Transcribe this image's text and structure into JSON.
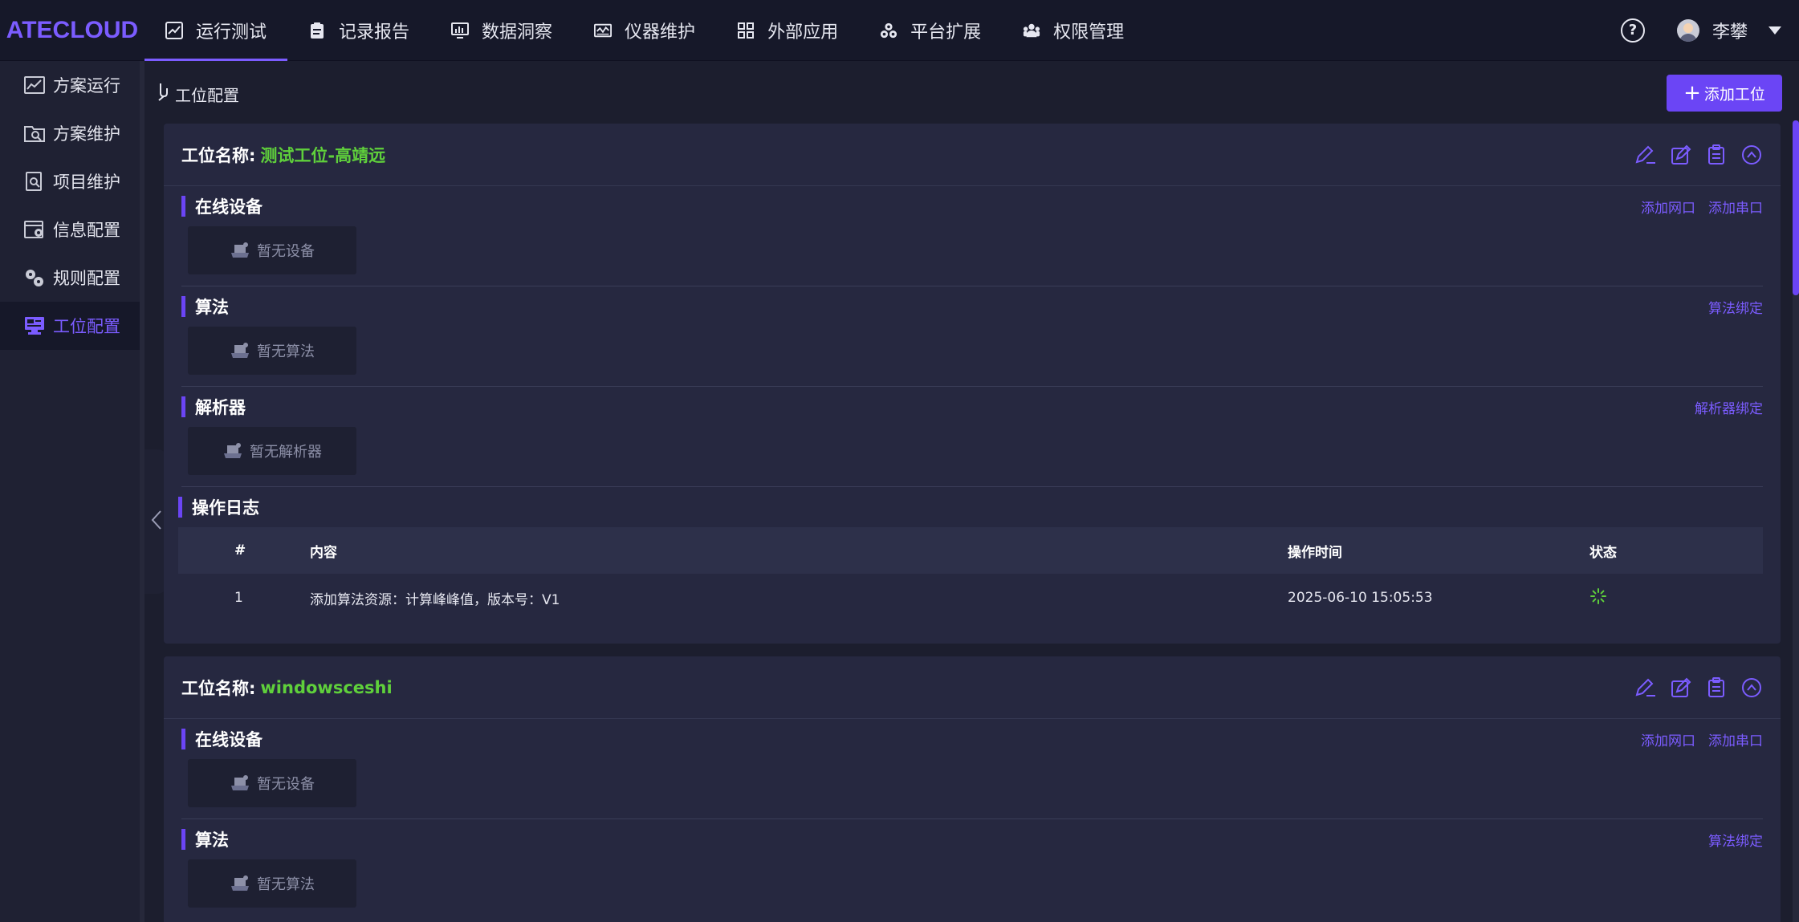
{
  "app": {
    "logo": "ATECLOUD"
  },
  "topnav": {
    "items": [
      {
        "label": "运行测试",
        "icon": "line-chart-icon",
        "active": true
      },
      {
        "label": "记录报告",
        "icon": "clipboard-icon",
        "active": false
      },
      {
        "label": "数据洞察",
        "icon": "monitor-chart-icon",
        "active": false
      },
      {
        "label": "仪器维护",
        "icon": "instrument-icon",
        "active": false
      },
      {
        "label": "外部应用",
        "icon": "grid-icon",
        "active": false
      },
      {
        "label": "平台扩展",
        "icon": "cubes-icon",
        "active": false
      },
      {
        "label": "权限管理",
        "icon": "users-icon",
        "active": false
      }
    ],
    "help_label": "?",
    "user_name": "李攀"
  },
  "sidebar": {
    "items": [
      {
        "label": "方案运行",
        "icon": "chart-window-icon",
        "active": false
      },
      {
        "label": "方案维护",
        "icon": "folder-search-icon",
        "active": false
      },
      {
        "label": "项目维护",
        "icon": "document-search-icon",
        "active": false
      },
      {
        "label": "信息配置",
        "icon": "settings-window-icon",
        "active": false
      },
      {
        "label": "规则配置",
        "icon": "gears-icon",
        "active": false
      },
      {
        "label": "工位配置",
        "icon": "workstation-icon",
        "active": true
      }
    ]
  },
  "main": {
    "breadcrumb": "工位配置",
    "add_button": "添加工位",
    "title_label": "工位名称:",
    "section_device": "在线设备",
    "section_algo": "算法",
    "section_parser": "解析器",
    "section_log": "操作日志",
    "link_add_net": "添加网口",
    "link_add_serial": "添加串口",
    "link_bind_algo": "算法绑定",
    "link_bind_parser": "解析器绑定",
    "empty_device": "暂无设备",
    "empty_algo": "暂无算法",
    "empty_parser": "暂无解析器",
    "log_columns": [
      "#",
      "内容",
      "操作时间",
      "状态"
    ],
    "stations": [
      {
        "name": "测试工位-高靖远",
        "logs": [
          {
            "index": "1",
            "content": "添加算法资源：计算峰峰值，版本号：V1",
            "time": "2025-06-10 15:05:53",
            "status": "loading-spinner-icon"
          }
        ]
      },
      {
        "name": "windowsceshi"
      }
    ]
  },
  "colors": {
    "accent": "#6b45f5",
    "success": "#5fd03b",
    "background": "#1c1e2e"
  }
}
